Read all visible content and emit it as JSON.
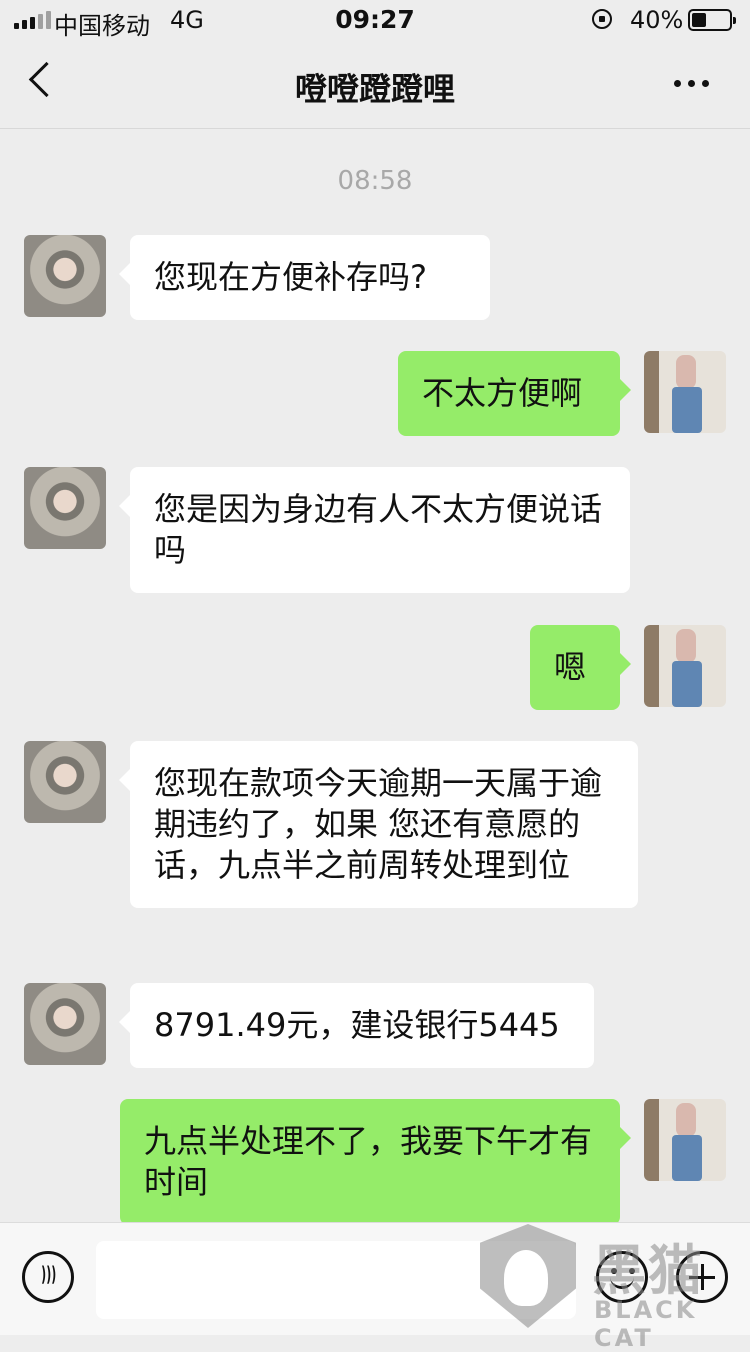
{
  "status_bar": {
    "carrier": "中国移动",
    "network": "4G",
    "time": "09:27",
    "battery_percent": "40%"
  },
  "nav": {
    "title": "噔噔蹬蹬哩"
  },
  "timestamp": "08:58",
  "messages": [
    {
      "side": "left",
      "text": "您现在方便补存吗?"
    },
    {
      "side": "right",
      "text": "不太方便啊"
    },
    {
      "side": "left",
      "text": "您是因为身边有人不太方便说话吗"
    },
    {
      "side": "right",
      "text": "嗯"
    },
    {
      "side": "left",
      "text": "您现在款项今天逾期一天属于逾期违约了，如果 您还有意愿的话，九点半之前周转处理到位"
    },
    {
      "side": "left",
      "text": "8791.49元，建设银行5445"
    },
    {
      "side": "right",
      "text": "九点半处理不了，我要下午才有时间"
    }
  ],
  "watermark": {
    "cn": "黑猫",
    "en": "BLACK CAT"
  },
  "colors": {
    "background": "#ededed",
    "incoming_bubble": "#ffffff",
    "outgoing_bubble": "#95ec69"
  }
}
